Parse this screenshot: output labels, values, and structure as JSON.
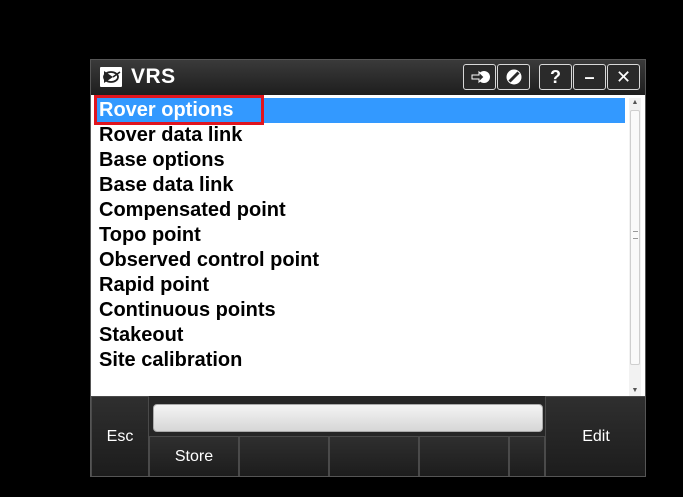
{
  "window": {
    "title": "VRS",
    "title_buttons": {
      "login": "login-arrow-icon",
      "prohibit": "no-entry-icon",
      "help": "?",
      "minimize": "–",
      "close": "✕"
    }
  },
  "list": {
    "selected_index": 0,
    "items": [
      {
        "label": "Rover options"
      },
      {
        "label": "Rover data link"
      },
      {
        "label": "Base options"
      },
      {
        "label": "Base data link"
      },
      {
        "label": "Compensated point"
      },
      {
        "label": "Topo point"
      },
      {
        "label": "Observed control point"
      },
      {
        "label": "Rapid point"
      },
      {
        "label": "Continuous points"
      },
      {
        "label": "Stakeout"
      },
      {
        "label": "Site calibration"
      }
    ]
  },
  "softkeys": {
    "esc": "Esc",
    "store": "Store",
    "edit": "Edit"
  },
  "colors": {
    "selection": "#3399ff",
    "highlight_box": "#e0141e",
    "titlebar": "#2a2a2a"
  }
}
